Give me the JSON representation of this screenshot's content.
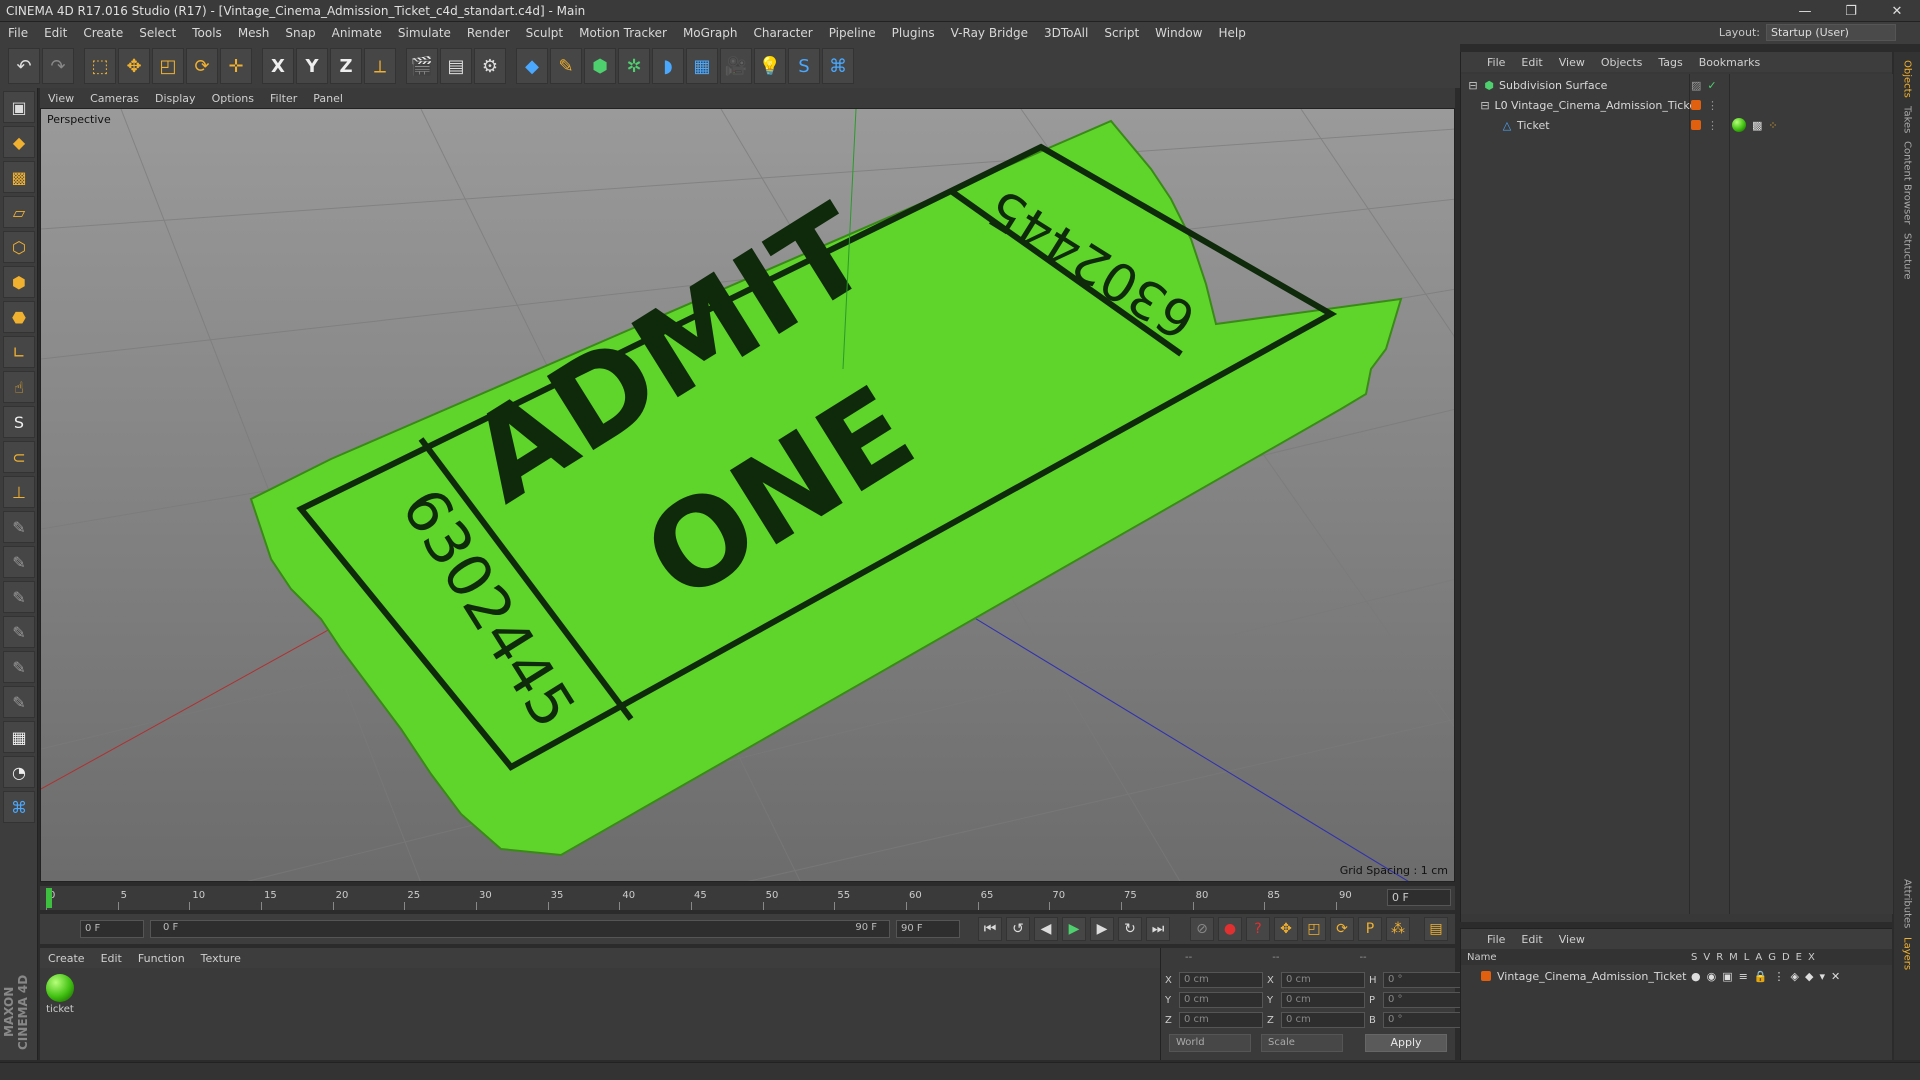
{
  "window": {
    "title": "CINEMA 4D R17.016 Studio (R17) - [Vintage_Cinema_Admission_Ticket_c4d_standart.c4d] - Main",
    "controls": [
      "—",
      "❐",
      "✕"
    ]
  },
  "menubar": {
    "items": [
      "File",
      "Edit",
      "Create",
      "Select",
      "Tools",
      "Mesh",
      "Snap",
      "Animate",
      "Simulate",
      "Render",
      "Sculpt",
      "Motion Tracker",
      "MoGraph",
      "Character",
      "Pipeline",
      "Plugins",
      "V-Ray Bridge",
      "3DToAll",
      "Script",
      "Window",
      "Help"
    ],
    "layout_label": "Layout:",
    "layout_value": "Startup (User)"
  },
  "toolbar": {
    "axis_x": "X",
    "axis_y": "Y",
    "axis_z": "Z"
  },
  "viewport": {
    "menu": [
      "View",
      "Cameras",
      "Display",
      "Options",
      "Filter",
      "Panel"
    ],
    "label": "Perspective",
    "grid_spacing": "Grid Spacing : 1 cm",
    "ticket": {
      "line1": "ADMIT",
      "line2": "ONE",
      "serial": "6302445",
      "color": "#5fd42a"
    }
  },
  "timeline": {
    "ticks": [
      "0",
      "5",
      "10",
      "15",
      "20",
      "25",
      "30",
      "35",
      "40",
      "45",
      "50",
      "55",
      "60",
      "65",
      "70",
      "75",
      "80",
      "85",
      "90"
    ],
    "current_frame": "0 F"
  },
  "transport": {
    "start_field": "0 F",
    "range_start": "0 F",
    "range_end": "90 F",
    "end_field": "90 F"
  },
  "material_panel": {
    "menu": [
      "Create",
      "Edit",
      "Function",
      "Texture"
    ],
    "material_name": "ticket"
  },
  "coords": {
    "headers": [
      "--",
      "--",
      "--"
    ],
    "rows": [
      {
        "a1": "X",
        "v1": "0 cm",
        "a2": "X",
        "v2": "0 cm",
        "a3": "H",
        "v3": "0 °"
      },
      {
        "a1": "Y",
        "v1": "0 cm",
        "a2": "Y",
        "v2": "0 cm",
        "a3": "P",
        "v3": "0 °"
      },
      {
        "a1": "Z",
        "v1": "0 cm",
        "a2": "Z",
        "v2": "0 cm",
        "a3": "B",
        "v3": "0 °"
      }
    ],
    "coord_mode": "World",
    "size_mode": "Scale",
    "apply_label": "Apply"
  },
  "objects_panel": {
    "menu": [
      "File",
      "Edit",
      "View",
      "Objects",
      "Tags",
      "Bookmarks"
    ],
    "items": [
      {
        "name": "Subdivision Surface"
      },
      {
        "name": "Vintage_Cinema_Admission_Ticket"
      },
      {
        "name": "Ticket"
      }
    ]
  },
  "layers_panel": {
    "menu": [
      "File",
      "Edit",
      "View"
    ],
    "header_name": "Name",
    "header_cols": [
      "S",
      "V",
      "R",
      "M",
      "L",
      "A",
      "G",
      "D",
      "E",
      "X"
    ],
    "layer_name": "Vintage_Cinema_Admission_Ticket"
  },
  "right_strip": [
    "Objects",
    "Takes",
    "Content Browser",
    "Structure",
    "Attributes",
    "Layers"
  ],
  "branding": "MAXON CINEMA 4D"
}
